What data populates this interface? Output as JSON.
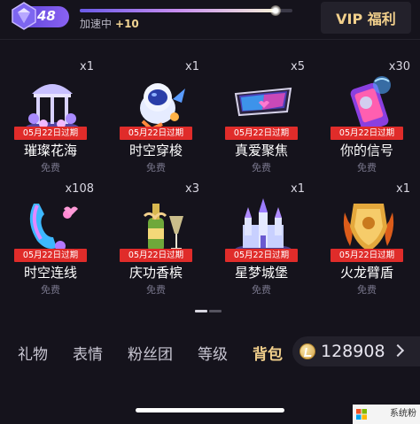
{
  "header": {
    "level": "48",
    "progress_label": "加速中",
    "progress_boost": "+10",
    "progress_fraction": 0.92,
    "vip_label": "VIP 福利"
  },
  "gifts": [
    {
      "name": "璀璨花海",
      "count": "x1",
      "expiry": "05月22日过期",
      "price": "免费",
      "icon": "gazebo-icon"
    },
    {
      "name": "时空穿梭",
      "count": "x1",
      "expiry": "05月22日过期",
      "price": "免费",
      "icon": "astronaut-icon"
    },
    {
      "name": "真爱聚焦",
      "count": "x5",
      "expiry": "05月22日过期",
      "price": "免费",
      "icon": "vr-glasses-icon"
    },
    {
      "name": "你的信号",
      "count": "x30",
      "expiry": "05月22日过期",
      "price": "免费",
      "icon": "phone-signal-icon"
    },
    {
      "name": "时空连线",
      "count": "x108",
      "expiry": "05月22日过期",
      "price": "免费",
      "icon": "telephone-icon"
    },
    {
      "name": "庆功香槟",
      "count": "x3",
      "expiry": "05月22日过期",
      "price": "免费",
      "icon": "champagne-icon"
    },
    {
      "name": "星梦城堡",
      "count": "x1",
      "expiry": "05月22日过期",
      "price": "免费",
      "icon": "castle-icon"
    },
    {
      "name": "火龙臂盾",
      "count": "x1",
      "expiry": "05月22日过期",
      "price": "免费",
      "icon": "fire-shield-icon"
    }
  ],
  "tabs": [
    {
      "label": "礼物",
      "active": false
    },
    {
      "label": "表情",
      "active": false
    },
    {
      "label": "粉丝团",
      "active": false
    },
    {
      "label": "等级",
      "active": false
    },
    {
      "label": "背包",
      "active": true
    }
  ],
  "wallet": {
    "balance": "128908",
    "icon": "coin-icon"
  },
  "watermark": "系统粉",
  "colors": {
    "background": "#15131c",
    "accent_gold": "#f2d08c",
    "expiry_red": "#e02c2a",
    "level_purple": "#6a4ee0"
  }
}
